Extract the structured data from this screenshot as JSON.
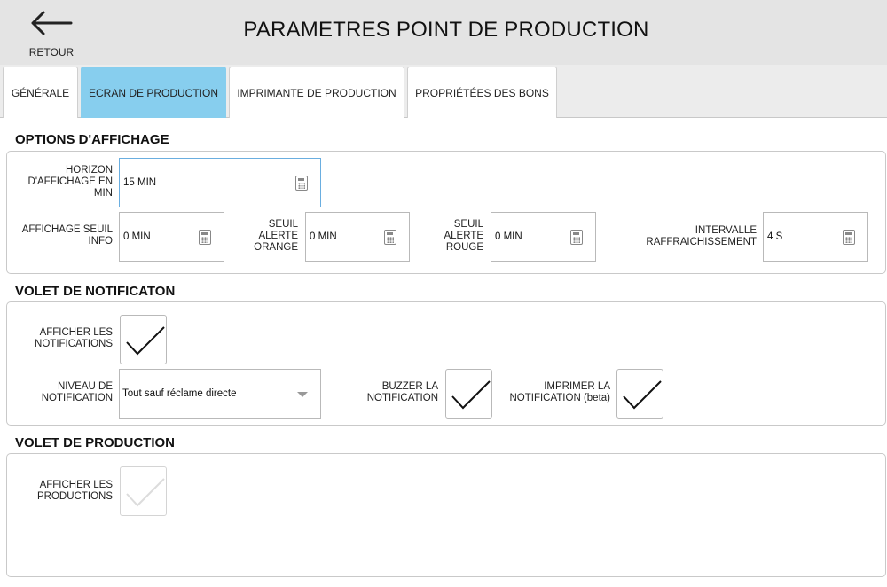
{
  "header": {
    "back_label": "RETOUR",
    "title": "PARAMETRES POINT DE PRODUCTION"
  },
  "tabs": [
    {
      "label": "GÉNÉRALE",
      "active": false
    },
    {
      "label": "ECRAN DE PRODUCTION",
      "active": true
    },
    {
      "label": "IMPRIMANTE DE PRODUCTION",
      "active": false
    },
    {
      "label": "PROPRIÉTÉES DES BONS",
      "active": false
    }
  ],
  "display_options": {
    "title": "OPTIONS D'AFFICHAGE",
    "horizon": {
      "label": "HORIZON D'AFFICHAGE EN MIN",
      "value": "15 MIN"
    },
    "seuil_info": {
      "label": "AFFICHAGE SEUIL INFO",
      "value": "0 MIN"
    },
    "seuil_orange": {
      "label": "SEUIL ALERTE ORANGE",
      "value": "0 MIN"
    },
    "seuil_rouge": {
      "label": "SEUIL ALERTE ROUGE",
      "value": "0 MIN"
    },
    "intervalle": {
      "label": "INTERVALLE RAFFRAICHISSEMENT",
      "value": "4 S"
    }
  },
  "notification_panel": {
    "title": "VOLET DE NOTIFICATON",
    "afficher": {
      "label": "AFFICHER LES NOTIFICATIONS",
      "checked": true
    },
    "niveau": {
      "label": "NIVEAU DE NOTIFICATION",
      "value": "Tout sauf réclame directe"
    },
    "buzzer": {
      "label": "BUZZER LA NOTIFICATION",
      "checked": true
    },
    "imprimer": {
      "label": "IMPRIMER LA NOTIFICATION (beta)",
      "checked": true
    }
  },
  "production_panel": {
    "title": "VOLET DE PRODUCTION",
    "afficher": {
      "label": "AFFICHER LES PRODUCTIONS",
      "checked": true,
      "disabled": true
    }
  },
  "colors": {
    "active_tab": "#87ceee",
    "focus_border": "#6aaee0",
    "header_bg": "#e4e4e4"
  },
  "icons": [
    "arrow-left-icon",
    "calculator-icon",
    "checkmark-icon",
    "dropdown-caret-icon"
  ]
}
